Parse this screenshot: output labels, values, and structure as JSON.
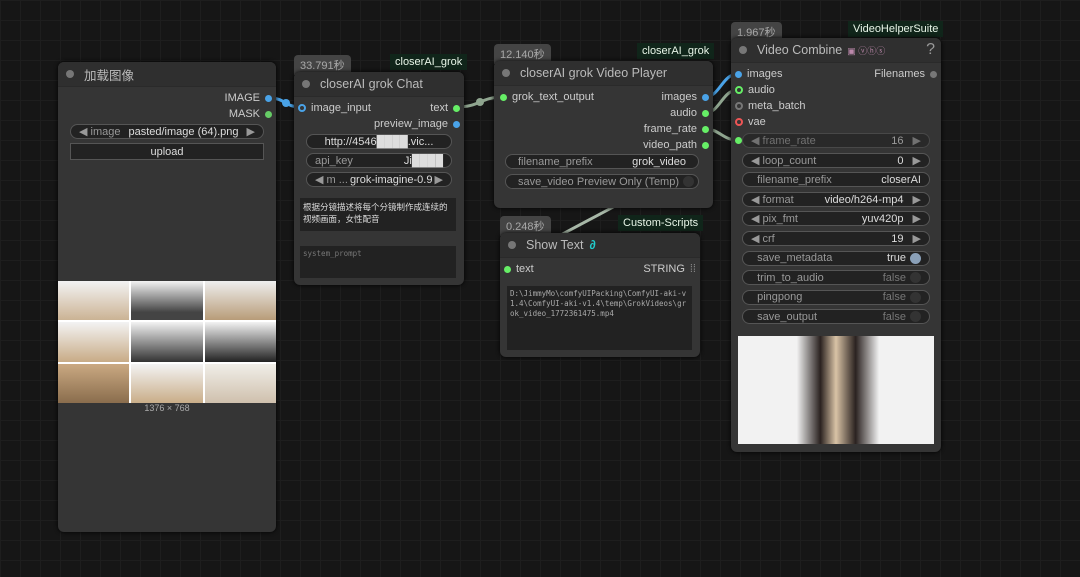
{
  "load_image": {
    "title": "加载图像",
    "outputs": [
      "IMAGE",
      "MASK"
    ],
    "image_label": "image",
    "image_value": "pasted/image (64).png",
    "upload_label": "upload",
    "size_caption": "1376 × 768"
  },
  "chat": {
    "time": "33.791秒",
    "tag": "closerAI_grok",
    "title": "closerAI grok Chat",
    "input": "image_input",
    "outputs": [
      "text",
      "preview_image"
    ],
    "url_value": "http://4546████.vic...",
    "api_key_label": "api_key",
    "api_key_value": "Ji████",
    "model_label": "m ...",
    "model_value": "grok-imagine-0.9",
    "prompt_text": "根据分镜描述将每个分镜制作成连续的视频画面，女性配音",
    "system_prompt_placeholder": "system_prompt"
  },
  "player": {
    "time": "12.140秒",
    "tag": "closerAI_grok",
    "title": "closerAI grok Video Player",
    "input": "grok_text_output",
    "outputs": [
      "images",
      "audio",
      "frame_rate",
      "video_path"
    ],
    "filename_prefix_label": "filename_prefix",
    "filename_prefix_value": "grok_video",
    "save_video_label": "save_video",
    "save_video_value": "Preview Only (Temp)"
  },
  "show_text": {
    "time": "0.248秒",
    "tag": "Custom-Scripts",
    "title": "Show Text",
    "input": "text",
    "output": "STRING",
    "content": "D:\\JimmyMo\\comfyUIPacking\\ComfyUI-aki-v1.4\\ComfyUI-aki-v1.4\\temp\\GrokVideos\\grok_video_1772361475.mp4"
  },
  "combine": {
    "time": "1.967秒",
    "tag": "VideoHelperSuite",
    "title": "Video Combine",
    "help": "?",
    "inputs": [
      "images",
      "audio",
      "meta_batch",
      "vae"
    ],
    "output": "Filenames",
    "widgets": [
      {
        "label": "frame_rate",
        "value": "16",
        "arrows": true
      },
      {
        "label": "loop_count",
        "value": "0",
        "arrows": true
      },
      {
        "label": "filename_prefix",
        "value": "closerAI",
        "arrows": false
      },
      {
        "label": "format",
        "value": "video/h264-mp4",
        "arrows": true
      },
      {
        "label": "pix_fmt",
        "value": "yuv420p",
        "arrows": true
      },
      {
        "label": "crf",
        "value": "19",
        "arrows": true
      },
      {
        "label": "save_metadata",
        "value": "true",
        "arrows": false
      },
      {
        "label": "trim_to_audio",
        "value": "false",
        "arrows": false
      },
      {
        "label": "pingpong",
        "value": "false",
        "arrows": false
      },
      {
        "label": "save_output",
        "value": "false",
        "arrows": false
      }
    ]
  }
}
